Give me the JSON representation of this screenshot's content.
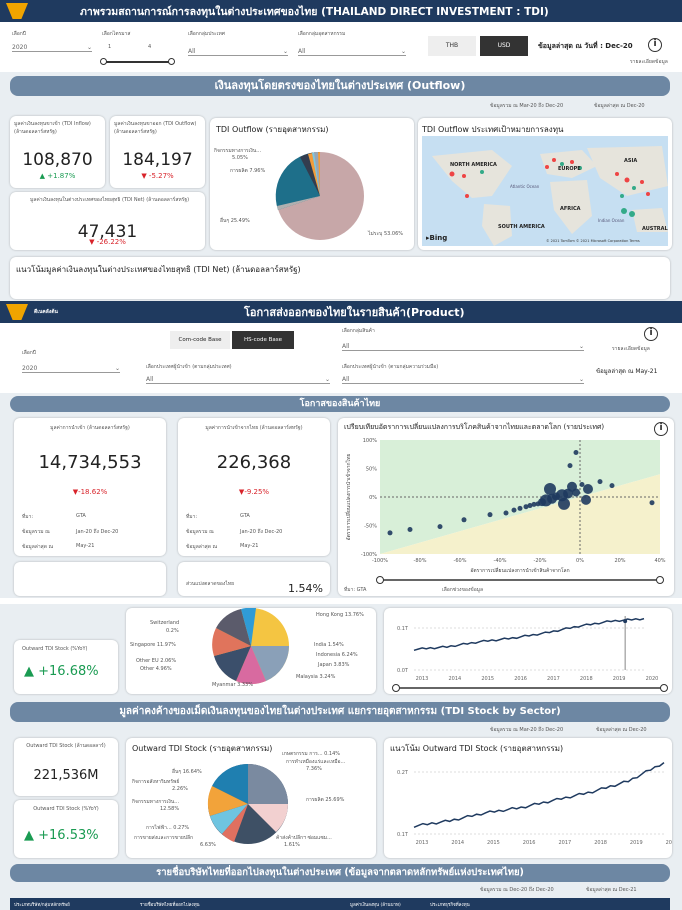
{
  "section1": {
    "title": "ภาพรวมสถานการณ์การลงทุนในต่างประเทศของไทย (THAILAND DIRECT INVESTMENT : TDI)",
    "filters": {
      "year_label": "เลือกปี",
      "year_value": "2020",
      "quarter_label": "เลือกไตรมาส",
      "quarter_min": "1",
      "quarter_max": "4",
      "country_group_label": "เลือกกลุ่มประเทศ",
      "country_group_value": "All",
      "sector_label": "เลือกกลุ่มอุตสาหกรรม",
      "sector_value": "All"
    },
    "currency": {
      "thb": "THB",
      "usd": "USD"
    },
    "latest_data": "ข้อมูลล่าสุด ณ วันที่ : Dec-20",
    "details": "รายละเอียดข้อมูล",
    "outflow_banner": "เงินลงทุนโดยตรงของไทยในต่างประเทศ (Outflow)",
    "data_range": "ข้อมูลรวม ณ Mar-20 ถึง Dec-20",
    "data_latest": "ข้อมูลล่าสุด ณ Dec-20",
    "inflow_label": "มูลค่าเงินลงทุนขาเข้า (TDI Inflow) (ล้านดอลลาร์สหรัฐ)",
    "inflow_value": "108,870",
    "inflow_change": "+1.87%",
    "outflow_label": "มูลค่าเงินลงทุนขาออก (TDI Outflow) (ล้านดอลลาร์สหรัฐ)",
    "outflow_value": "184,197",
    "outflow_change": "-5.27%",
    "net_label": "มูลค่าเงินลงทุนในต่างประเทศของไทยสุทธิ (TDI Net) (ล้านดอลลาร์สหรัฐ)",
    "net_value": "47,431",
    "net_change": "-26.22%",
    "pie_title": "TDI Outflow (รายอุตสาหกรรม)",
    "pie_labels": {
      "finance": "กิจกรรมทางการเงิน...",
      "finance_pct": "5.05%",
      "manufacturing": "การผลิต 7.96%",
      "other": "อื่นๆ 25.49%",
      "unknown": "ไม่ระบุ 53.06%"
    },
    "map_title": "TDI Outflow ประเทศเป้าหมายการลงทุน",
    "map_labels": {
      "na": "NORTH AMERICA",
      "eu": "EUROPE",
      "asia": "ASIA",
      "africa": "AFRICA",
      "sa": "SOUTH AMERICA",
      "aus": "AUSTRAL",
      "atlantic": "Atlantic Ocean",
      "indian": "Indian Ocean",
      "bing": "Bing",
      "copyright": "© 2021 TomTom © 2021 Microsoft Corporation Terms"
    },
    "trend_title": "แนวโน้มมูลค่าเงินลงทุนในต่างประเทศของไทยสุทธิ (TDI Net) (ล้านดอลลาร์สหรัฐ)"
  },
  "section2": {
    "home": "ดีเนคลังต้น",
    "title": "โอกาสส่งออกของไทยในรายสินค้า(Product)",
    "toggle": {
      "com": "Com-code Base",
      "hs": "HS-code Base"
    },
    "product_group_label": "เลือกกลุ่มสินค้า",
    "product_group_value": "All",
    "details": "รายละเอียดข้อมูล",
    "year_label": "เลือกปี",
    "year_value": "2020",
    "importer_label": "เลือกประเทศผู้นำเข้า (ตามกลุ่มประเทศ)",
    "importer_value": "All",
    "importer2_label": "เลือกประเทศผู้นำเข้า (ตามกลุ่มความร่วมมือ)",
    "importer2_value": "All",
    "latest": "ข้อมูลล่าสุด ณ May-21",
    "banner": "โอกาสของสินค้าไทย",
    "import_label": "มูลค่าการนำเข้า (ล้านดอลลาร์สหรัฐ)",
    "import_value": "14,734,553",
    "import_change": "-18.62%",
    "thai_import_label": "มูลค่าการนำเข้าจากไทย (ล้านดอลลาร์สหรัฐ)",
    "thai_import_value": "226,368",
    "thai_import_change": "-9.25%",
    "meta": {
      "source_k": "ที่มา:",
      "source_v": "GTA",
      "range_k": "ข้อมูลรวม ณ",
      "range_v": "Jan-20 ถึง Dec-20",
      "latest_k": "ข้อมูลล่าสุด ณ",
      "latest_v": "May-21"
    },
    "share_label": "ส่วนแบ่งตลาดของไทย",
    "share_value": "1.54%",
    "scatter_title": "เปรียบเทียบอัตราการเปลี่ยนแปลงการบริโภคสินค้าจากไทยและตลาดโลก (รายประเทศ)",
    "scatter_ylabel": "อัตราการเปลี่ยนแปลงการนำเข้าจากไทย",
    "scatter_xlabel": "อัตราการเปลี่ยนแปลงการนำเข้าสินค้าจากโลก",
    "scatter_source": "ที่มา: GTA",
    "scatter_footer": "เลือกช่วงของข้อมูล"
  },
  "chart_data": [
    {
      "type": "pie",
      "title": "TDI Outflow (รายอุตสาหกรรม)",
      "categories": [
        "ไม่ระบุ",
        "อื่นๆ",
        "การผลิต",
        "กิจกรรมทางการเงินและการประกันภัย"
      ],
      "values": [
        53.06,
        25.49,
        7.96,
        5.05
      ]
    },
    {
      "type": "scatter",
      "title": "เปรียบเทียบอัตราการเปลี่ยนแปลงการบริโภคสินค้าจากไทยและตลาดโลก (รายประเทศ)",
      "xlabel": "อัตราการเปลี่ยนแปลงการนำเข้าสินค้าจากโลก",
      "ylabel": "อัตราการเปลี่ยนแปลงการนำเข้าจากไทย",
      "xlim": [
        -100,
        40
      ],
      "ylim": [
        -100,
        100
      ],
      "x_ticks": [
        "-100%",
        "-80%",
        "-60%",
        "-40%",
        "-20%",
        "0%",
        "20%",
        "40%"
      ],
      "y_ticks": [
        "100%",
        "50%",
        "0%",
        "-50%",
        "-100%"
      ],
      "points": [
        {
          "x": -2,
          "y": 78
        },
        {
          "x": -5,
          "y": 55
        },
        {
          "x": 1,
          "y": 22
        },
        {
          "x": -2,
          "y": 8
        },
        {
          "x": -6,
          "y": 6
        },
        {
          "x": -9,
          "y": 3
        },
        {
          "x": -12,
          "y": 1
        },
        {
          "x": -14,
          "y": -3
        },
        {
          "x": -17,
          "y": -6
        },
        {
          "x": -19,
          "y": -9
        },
        {
          "x": -21,
          "y": -12
        },
        {
          "x": -23,
          "y": -13
        },
        {
          "x": -25,
          "y": -15
        },
        {
          "x": -27,
          "y": -17
        },
        {
          "x": -30,
          "y": -20
        },
        {
          "x": -33,
          "y": -23
        },
        {
          "x": -37,
          "y": -28
        },
        {
          "x": -45,
          "y": -31
        },
        {
          "x": -58,
          "y": -40
        },
        {
          "x": -70,
          "y": -52
        },
        {
          "x": -85,
          "y": -57
        },
        {
          "x": -95,
          "y": -63
        },
        {
          "x": 4,
          "y": 14
        },
        {
          "x": 10,
          "y": 27
        },
        {
          "x": 16,
          "y": 20
        },
        {
          "x": 3,
          "y": -5
        },
        {
          "x": -8,
          "y": -12
        },
        {
          "x": 36,
          "y": -10
        },
        {
          "x": -4,
          "y": 18
        },
        {
          "x": -15,
          "y": 14
        }
      ]
    },
    {
      "type": "pie",
      "title": "",
      "categories": [
        "Hong Kong",
        "India",
        "Indonesia",
        "Japan",
        "Malaysia",
        "Myanmar",
        "Other",
        "Other EU",
        "Singapore",
        "Switzerland"
      ],
      "values": [
        13.76,
        1.54,
        6.24,
        3.83,
        3.24,
        3.33,
        4.96,
        2.06,
        11.97,
        0.2
      ]
    },
    {
      "type": "line",
      "title": "",
      "x": [
        "2013",
        "2014",
        "2015",
        "2016",
        "2017",
        "2018",
        "2019",
        "2020"
      ],
      "y_ticks": [
        "0.1T",
        "0.0T"
      ],
      "values": [
        0.04,
        0.045,
        0.055,
        0.062,
        0.072,
        0.085,
        0.095,
        0.1
      ],
      "marker_year": "2019"
    },
    {
      "type": "pie",
      "title": "Outward TDI Stock (รายอุตสาหกรรม)",
      "categories": [
        "การผลิต",
        "อื่นๆ",
        "กิจกรรมทางการเงินและการประกันภัย",
        "การทำเหมืองแร่และเหมืองหิน",
        "กิจการอสังหาริมทรัพย์",
        "การขายส่งและการขายปลีก",
        "ค้าส่งค้าปลีก",
        "เกษตรกรรม",
        "การไฟฟ้า"
      ],
      "values": [
        25.69,
        16.64,
        12.58,
        7.36,
        2.26,
        6.63,
        1.61,
        0.14,
        0.27
      ]
    },
    {
      "type": "line",
      "title": "แนวโน้ม Outward TDI Stock (รายอุตสาหกรรม)",
      "x": [
        "2013",
        "2014",
        "2015",
        "2016",
        "2017",
        "2018",
        "2019",
        "2020"
      ],
      "y_ticks": [
        "0.2T",
        "0.1T"
      ],
      "values": [
        0.085,
        0.095,
        0.11,
        0.12,
        0.135,
        0.15,
        0.17,
        0.205
      ]
    }
  ],
  "section3": {
    "stock_yoy_label": "Outward TDI Stock (%YoY)",
    "stock_yoy_value": "+16.68%",
    "pie_labels": {
      "switzerland": "Switzerland",
      "switzerland_pct": "0.2%",
      "singapore": "Singapore 11.97%",
      "other_eu": "Other EU 2.06%",
      "other": "Other 4.96%",
      "myanmar": "Myanmar 3.33%",
      "hongkong": "Hong Kong 13.76%",
      "india": "India 1.54%",
      "indonesia": "Indonesia 6.24%",
      "japan": "Japan 3.83%",
      "malaysia": "Malaysia 3.24%"
    },
    "years": [
      "2013",
      "2014",
      "2015",
      "2016",
      "2017",
      "2018",
      "2019",
      "2020"
    ],
    "yticks": {
      "top": "0.1T",
      "bottom": "0.0T"
    }
  },
  "section4": {
    "banner": "มูลค่าคงค้างของเม็ดเงินลงทุนของไทยในต่างประเทศ แยกรายอุตสาหกรรม (TDI Stock by Sector)",
    "data_range": "ข้อมูลรวม ณ Mar-20 ถึง Dec-20",
    "data_latest": "ข้อมูลล่าสุด ณ Dec-20",
    "stock_label": "Outward TDI Stock (ล้านดอลลาร์)",
    "stock_value": "221,536M",
    "yoy_label": "Outward TDI Stock (%YoY)",
    "yoy_value": "+16.53%",
    "pie_title": "Outward TDI Stock (รายอุตสาหกรรม)",
    "pie_labels": {
      "agri": "เกษตรกรรม การ... 0.14%",
      "mining": "การทำเหมืองแร่และเหมือ...",
      "mining_pct": "7.36%",
      "manufacturing": "การผลิต 25.69%",
      "other": "อื่นๆ 16.64%",
      "realestate": "กิจการอสังหาริมทรัพย์",
      "realestate_pct": "2.26%",
      "finance": "กิจกรรมทางการเงิน...",
      "finance_pct": "12.58%",
      "electric": "การไฟฟ้า... 0.27%",
      "trade": "การขายส่งและการขายปลีก",
      "trade_pct": "6.63%",
      "wholesale": "ค้าส่งค้าปลีกฯ ซ่อมแซม...",
      "wholesale_pct": "1.61%"
    },
    "trend_title": "แนวโน้ม Outward TDI Stock (รายอุตสาหกรรม)",
    "years": [
      "2013",
      "2014",
      "2015",
      "2016",
      "2017",
      "2018",
      "2019",
      "2020"
    ],
    "yticks": {
      "top": "0.2T",
      "bottom": "0.1T"
    }
  },
  "section5": {
    "banner": "รายชื่อบริษัทไทยที่ออกไปลงทุนในต่างประเทศ (ข้อมูลจากตลาดหลักทรัพย์แห่งประเทศไทย)",
    "data_range": "ข้อมูลรวม ณ Dec-20 ถึง Dec-20",
    "data_latest": "ข้อมูลล่าสุด ณ Dec-21",
    "columns": [
      "ประเภทบริษัท/กลุ่มหลักทรัพย์",
      "รายชื่อบริษัทไทยที่ออกไปลงทุน",
      "มูลค่าเงินลงทุน (ล้านบาท)",
      "ประเภทธุรกิจที่ลงทุน"
    ]
  }
}
